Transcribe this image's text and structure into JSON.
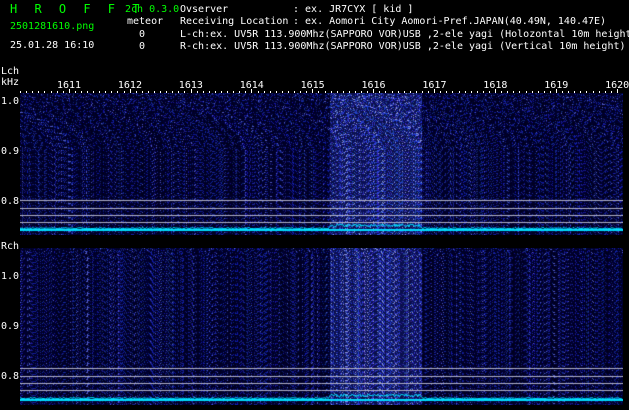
{
  "header": {
    "app_title": "H R O F F T",
    "filename": "2501281610.png",
    "datetime": "25.01.28 16:10",
    "mode": "2ch 0.3.0",
    "meteor_label": "meteor",
    "meteor_count_l": "0",
    "meteor_count_r": "0",
    "observer_label": "Ovserver",
    "observer_value": ": ex. JR7CYX [ kid ]",
    "location_label": "Receiving Location",
    "location_value": ": ex. Aomori City Aomori-Pref.JAPAN(40.49N, 140.47E)",
    "lch_info": "L-ch:ex. UV5R 113.900Mhz(SAPPORO VOR)USB ,2-ele yagi (Holozontal 10m height)",
    "rch_info": "R-ch:ex. UV5R 113.900Mhz(SAPPORO VOR)USB ,2-ele yagi (Vertical 10m height)"
  },
  "axis": {
    "lch_label": "Lch",
    "khz_label": "kHz",
    "rch_label": "Rch",
    "freq_ticks": [
      "1611",
      "1612",
      "1613",
      "1614",
      "1615",
      "1616",
      "1617",
      "1618",
      "1619",
      "1620"
    ],
    "lch_y_labels": [
      "1.0",
      "0.9",
      "0.8"
    ],
    "rch_y_labels": [
      "1.0",
      "0.9",
      "0.8"
    ]
  },
  "colors": {
    "background": "#000000",
    "title_green": "#00ff00",
    "trace_cyan": "#00e0ff",
    "noise_blue": "#1a2aa0",
    "signal_band": "#3040c0"
  },
  "signal_band_khz": [
    1615.3,
    1616.8
  ]
}
